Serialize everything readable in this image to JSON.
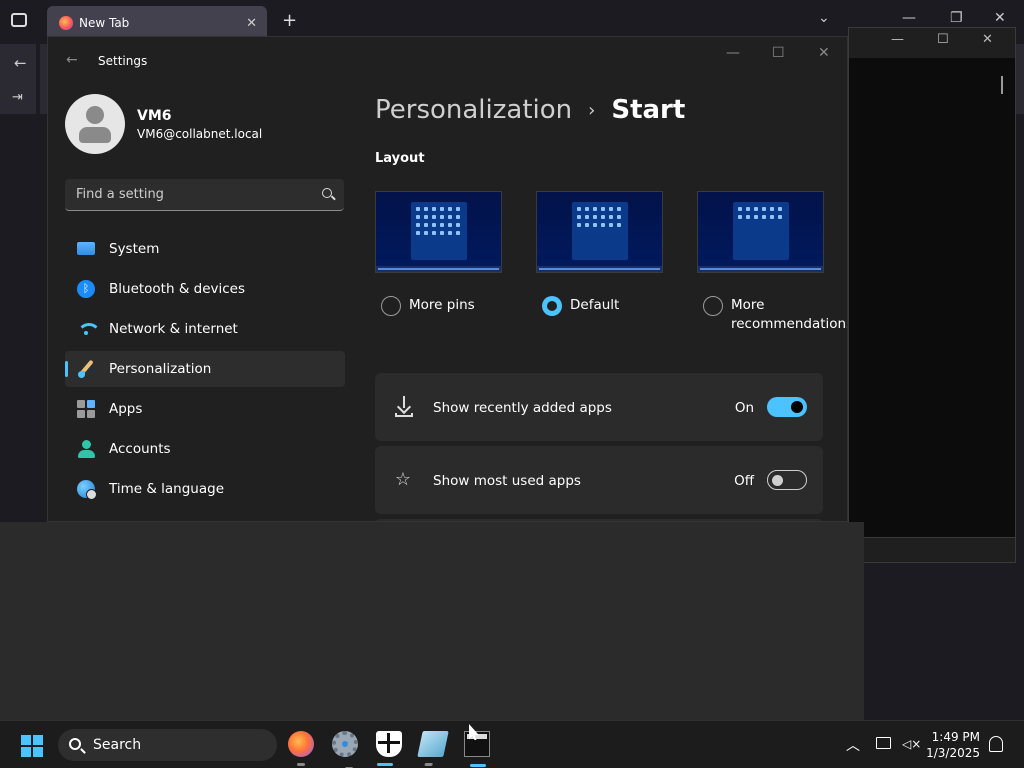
{
  "browser": {
    "tab_title": "New Tab",
    "tab_close": "✕",
    "new_tab": "+"
  },
  "settings": {
    "app_title": "Settings",
    "profile": {
      "name": "VM6",
      "email": "VM6@collabnet.local"
    },
    "search": {
      "placeholder": "Find a setting"
    },
    "nav": [
      {
        "label": "System",
        "icon": "system-icon"
      },
      {
        "label": "Bluetooth & devices",
        "icon": "bluetooth-icon"
      },
      {
        "label": "Network & internet",
        "icon": "wifi-icon"
      },
      {
        "label": "Personalization",
        "icon": "brush-icon",
        "active": true
      },
      {
        "label": "Apps",
        "icon": "apps-icon"
      },
      {
        "label": "Accounts",
        "icon": "accounts-icon"
      },
      {
        "label": "Time & language",
        "icon": "globe-clock-icon"
      }
    ],
    "breadcrumb": {
      "parent": "Personalization",
      "separator": "›",
      "current": "Start"
    },
    "layout": {
      "section_label": "Layout",
      "options": [
        {
          "label": "More pins",
          "selected": false
        },
        {
          "label": "Default",
          "selected": true
        },
        {
          "label": "More recommendations",
          "selected": false
        }
      ]
    },
    "cards": [
      {
        "label": "Show recently added apps",
        "state": "On",
        "on": true
      },
      {
        "label": "Show most used apps",
        "state": "Off",
        "on": false
      }
    ]
  },
  "taskbar": {
    "search_label": "Search",
    "time": "1:49 PM",
    "date": "1/3/2025"
  },
  "colors": {
    "accent": "#4cc2ff",
    "background": "#202020",
    "card": "#2b2b2b"
  }
}
